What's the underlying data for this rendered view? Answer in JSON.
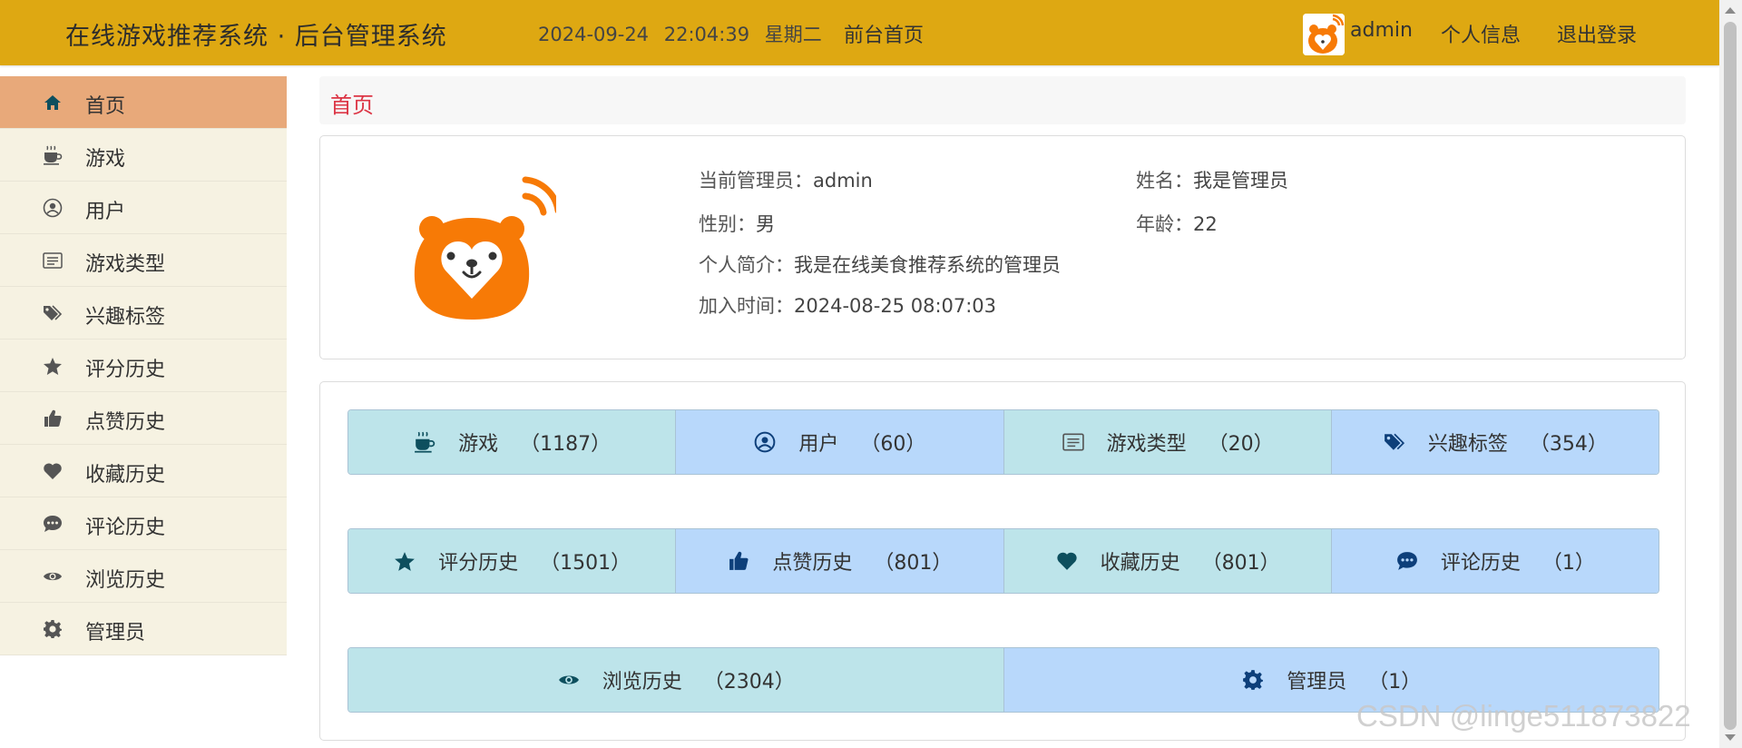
{
  "header": {
    "title": "在线游戏推荐系统 · 后台管理系统",
    "date": "2024-09-24",
    "time": "22:04:39",
    "weekday": "星期二",
    "home_link": "前台首页",
    "username": "admin",
    "profile_link": "个人信息",
    "logout_link": "退出登录"
  },
  "sidebar": {
    "items": [
      {
        "label": "首页",
        "icon": "home-icon",
        "active": true
      },
      {
        "label": "游戏",
        "icon": "coffee-icon"
      },
      {
        "label": "用户",
        "icon": "user-circle-icon"
      },
      {
        "label": "游戏类型",
        "icon": "list-icon"
      },
      {
        "label": "兴趣标签",
        "icon": "tags-icon"
      },
      {
        "label": "评分历史",
        "icon": "star-icon"
      },
      {
        "label": "点赞历史",
        "icon": "thumbs-up-icon"
      },
      {
        "label": "收藏历史",
        "icon": "heart-icon"
      },
      {
        "label": "评论历史",
        "icon": "comment-icon"
      },
      {
        "label": "浏览历史",
        "icon": "eye-icon"
      },
      {
        "label": "管理员",
        "icon": "gear-icon"
      }
    ]
  },
  "breadcrumb": "首页",
  "profile": {
    "admin_label": "当前管理员：",
    "admin_value": "admin",
    "name_label": "姓名：",
    "name_value": "我是管理员",
    "gender_label": "性别：",
    "gender_value": "男",
    "age_label": "年龄：",
    "age_value": "22",
    "bio_label": "个人简介：",
    "bio_value": "我是在线美食推荐系统的管理员",
    "joined_label": "加入时间：",
    "joined_value": "2024-08-25 08:07:03"
  },
  "stats": [
    {
      "label": "游戏",
      "count": "（1187）",
      "icon": "coffee-icon"
    },
    {
      "label": "用户",
      "count": "（60）",
      "icon": "user-circle-icon"
    },
    {
      "label": "游戏类型",
      "count": "（20）",
      "icon": "list-icon"
    },
    {
      "label": "兴趣标签",
      "count": "（354）",
      "icon": "tags-icon"
    },
    {
      "label": "评分历史",
      "count": "（1501）",
      "icon": "star-icon"
    },
    {
      "label": "点赞历史",
      "count": "（801）",
      "icon": "thumbs-up-icon"
    },
    {
      "label": "收藏历史",
      "count": "（801）",
      "icon": "heart-icon"
    },
    {
      "label": "评论历史",
      "count": "（1）",
      "icon": "comment-icon"
    },
    {
      "label": "浏览历史",
      "count": "（2304）",
      "icon": "eye-icon"
    },
    {
      "label": "管理员",
      "count": "（1）",
      "icon": "gear-icon"
    }
  ],
  "watermark": "CSDN @linge511873822",
  "colors": {
    "header_bg": "#dea812",
    "sidebar_bg": "#f6f2e2",
    "sidebar_active": "#e8a97a",
    "stat_teal": "#bde4ea",
    "stat_blue": "#b8d8fb",
    "icon_dark": "#0d4f5e",
    "breadcrumb_red": "#dc3545",
    "logo_orange": "#f77a06"
  }
}
